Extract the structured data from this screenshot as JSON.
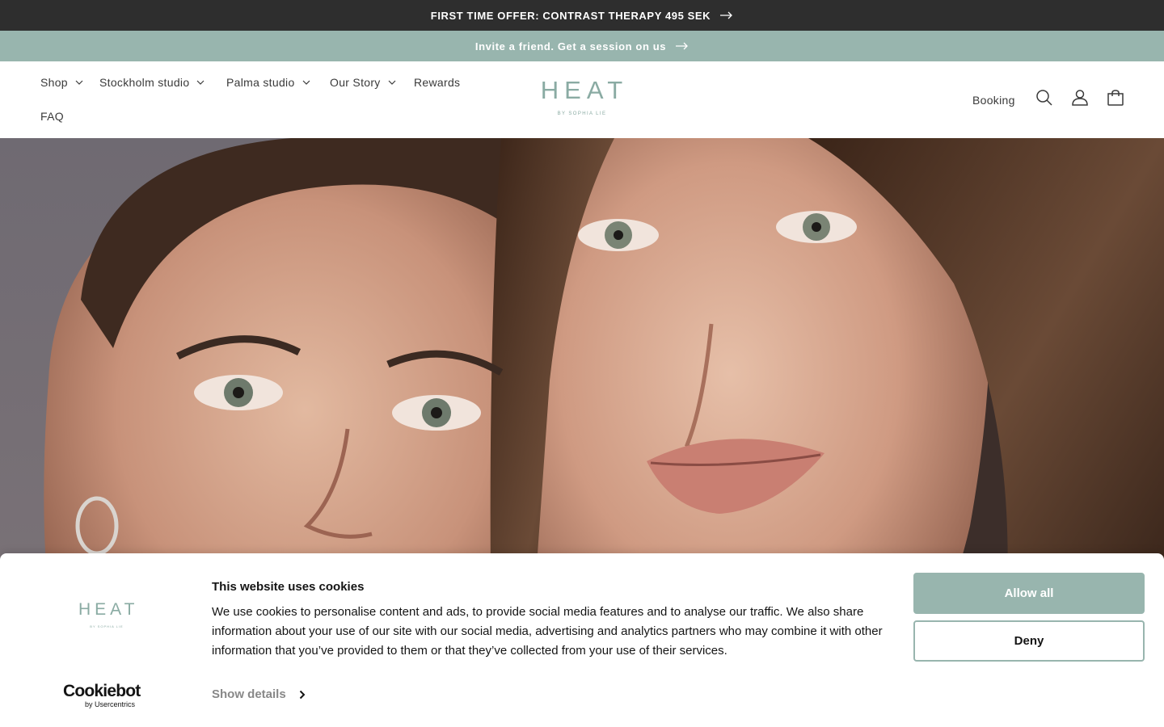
{
  "announcements": {
    "offer": "FIRST TIME OFFER: CONTRAST THERAPY 495 SEK",
    "invite": "Invite a friend. Get a session on us"
  },
  "nav": {
    "items": [
      {
        "label": "Shop",
        "dropdown": true
      },
      {
        "label": "Stockholm studio",
        "dropdown": true
      },
      {
        "label": "Palma studio",
        "dropdown": true
      },
      {
        "label": "Our Story",
        "dropdown": true
      },
      {
        "label": "Rewards",
        "dropdown": false
      },
      {
        "label": "FAQ",
        "dropdown": false
      }
    ],
    "booking": "Booking"
  },
  "logo": {
    "word": "HEAT",
    "tagline": "BY SOPHIA LIE"
  },
  "cookie_banner": {
    "title": "This website uses cookies",
    "text": "We use cookies to personalise content and ads, to provide social media features and to analyse our traffic. We also share information about your use of our site with our social media, advertising and analytics partners who may combine it with other information that you’ve provided to them or that they’ve collected from your use of their services.",
    "show_details": "Show details",
    "allow_all": "Allow all",
    "deny": "Deny",
    "provider_name": "Cookiebot",
    "provider_by": "by Usercentrics"
  },
  "colors": {
    "accent": "#98b5ae",
    "topbar": "#2e2e2e"
  }
}
